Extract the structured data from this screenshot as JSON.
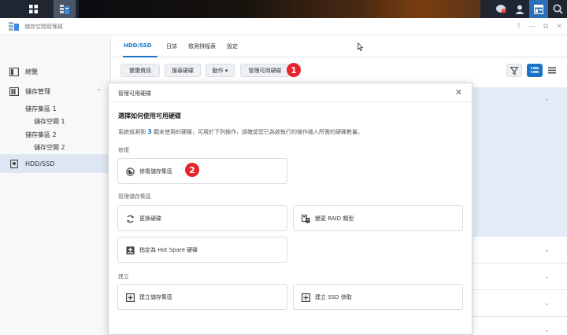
{
  "window": {
    "title": "儲存空間管理員"
  },
  "sidebar": {
    "overview": "總覽",
    "storage": "儲存管理",
    "pool1": "儲存集區 1",
    "vol1": "儲存空間 1",
    "pool2": "儲存集區 2",
    "vol2": "儲存空間 2",
    "hdd": "HDD/SSD"
  },
  "tabs": [
    "HDD/SSD",
    "日誌",
    "檢測排程表",
    "設定"
  ],
  "toolbar": {
    "health": "健康資訊",
    "search": "搜尋硬碟",
    "action": "動作 ▾",
    "manage": "管理可用硬碟"
  },
  "badges": {
    "step1": "1",
    "step2": "2"
  },
  "dialog": {
    "title": "管理可用硬碟",
    "close": "✕",
    "heading": "選擇如何使用可用硬碟",
    "desc_prefix": "系統偵測到 ",
    "desc_count": "3",
    "desc_suffix": " 顆未使用的硬碟，可用於下列操作，請確認您已為欲執行的操作插入所需的硬碟數量。",
    "section_repair": "修復",
    "repair_pool": "修復儲存集區",
    "section_manage": "管理儲存集區",
    "replace_drive": "更換硬碟",
    "change_raid": "變更 RAID 類型",
    "hot_spare": "指定為 Hot Spare 硬碟",
    "section_create": "建立",
    "create_pool": "建立儲存集區",
    "create_cache": "建立 SSD 快取"
  },
  "colors": {
    "accent": "#1a73c7",
    "badge": "#e5262a"
  }
}
